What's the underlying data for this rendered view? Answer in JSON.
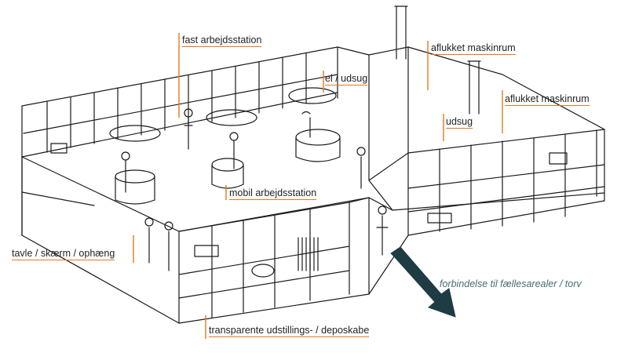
{
  "colors": {
    "accent": "#e07a1f",
    "ink": "#1a1a1a",
    "arrow": "#1f3c44"
  },
  "labels": {
    "fast_arbejdsstation": "fast arbejdsstation",
    "aflukket_maskinrum_1": "aflukket maskinrum",
    "el_udsug": "el / udsug",
    "aflukket_maskinrum_2": "aflukket maskinrum",
    "udsug": "udsug",
    "mobil_arbejdsstation": "mobil arbejdsstation",
    "tavle": "tavle / skærm / ophæng",
    "transparente": "transparente udstillings- / deposkabe",
    "forbindelse": "forbindelse til fællesarealer / torv"
  }
}
